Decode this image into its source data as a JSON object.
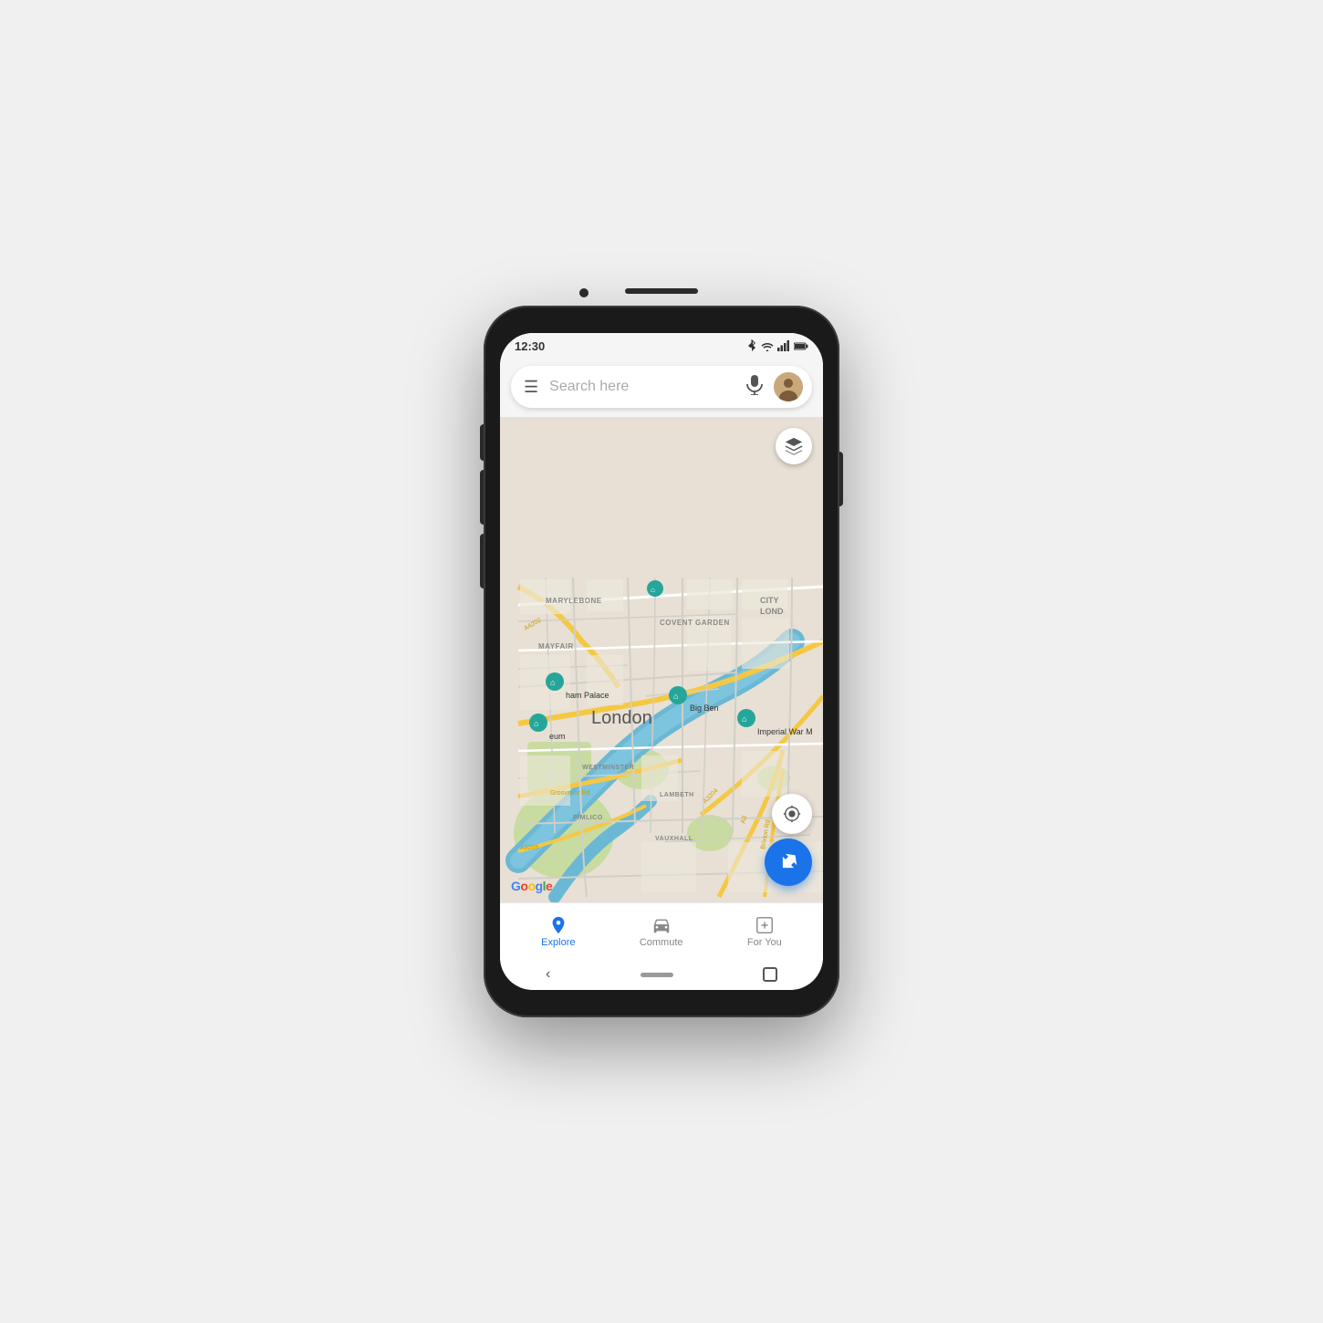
{
  "phone": {
    "status_bar": {
      "time": "12:30",
      "icons": [
        "bluetooth",
        "wifi",
        "signal",
        "battery"
      ]
    },
    "search_bar": {
      "placeholder": "Search here",
      "menu_icon": "☰",
      "mic_icon": "🎤"
    },
    "map": {
      "city_label": "London",
      "district_labels": [
        "MARYLEBONE",
        "MAYFAIR",
        "COVENT GARDEN",
        "CITY LOND",
        "WESTMINSTER",
        "PIMLICO",
        "LAMBETH",
        "VAUXHALL"
      ],
      "road_labels": [
        "A4202",
        "Grosvenor Rd",
        "A3205",
        "A3204",
        "A3",
        "Brixton Rd"
      ],
      "poi_labels": [
        "Big Ben",
        "Imperial War M",
        "ham Palace",
        "eum"
      ],
      "layer_button_icon": "layers",
      "location_button_icon": "my-location",
      "navigate_button_icon": "directions"
    },
    "google_logo": {
      "g": "G",
      "o1": "o",
      "o2": "o",
      "g2": "g",
      "l": "l",
      "e": "e"
    },
    "bottom_nav": {
      "items": [
        {
          "id": "explore",
          "label": "Explore",
          "icon": "location-pin",
          "active": true
        },
        {
          "id": "commute",
          "label": "Commute",
          "icon": "car",
          "active": false
        },
        {
          "id": "for-you",
          "label": "For You",
          "icon": "star-add",
          "active": false
        }
      ]
    },
    "android_nav": {
      "back_icon": "‹"
    }
  }
}
